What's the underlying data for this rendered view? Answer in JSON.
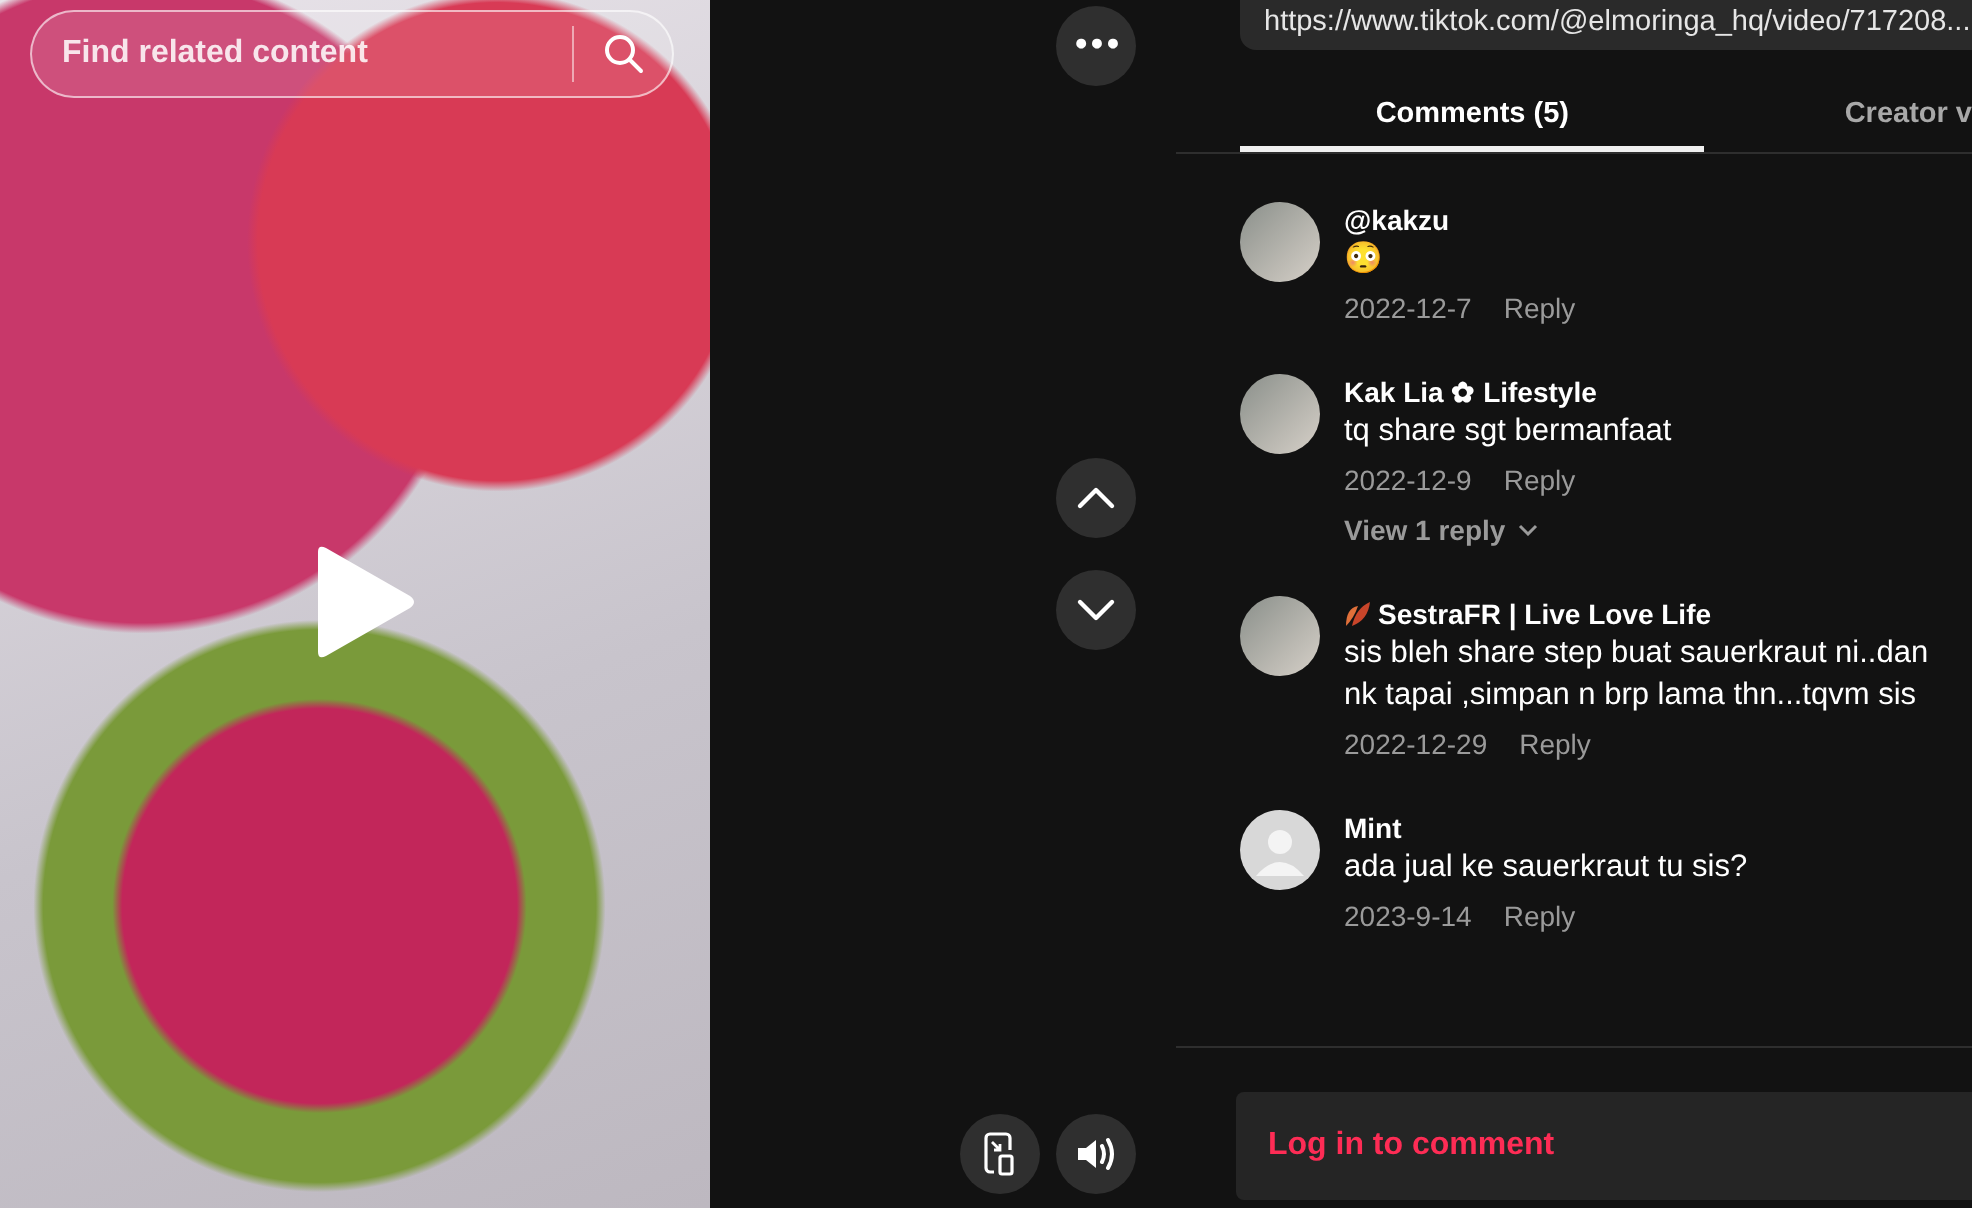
{
  "video": {
    "search": {
      "placeholder": "Find related content"
    }
  },
  "controls": {
    "more": "•••"
  },
  "share": {
    "url": "https://www.tiktok.com/@elmoringa_hq/video/717208..."
  },
  "tabs": [
    {
      "label": "Comments (5)",
      "selected": true
    },
    {
      "label": "Creator v",
      "selected": false
    }
  ],
  "comments": [
    {
      "kind": "photo",
      "author": "@kakzu",
      "lines": [
        "😳"
      ],
      "date": "2022-12-7",
      "reply": "Reply"
    },
    {
      "kind": "photo",
      "author": "Kak Lia ✿ Lifestyle",
      "lines": [
        "tq share sgt bermanfaat"
      ],
      "date": "2022-12-9",
      "reply": "Reply",
      "view_replies": "View 1 reply"
    },
    {
      "kind": "photo",
      "badge": true,
      "author": "SestraFR | Live Love Life",
      "lines": [
        "sis bleh share step buat sauerkraut ni..dan",
        "nk tapai ,simpan n brp lama thn...tqvm sis"
      ],
      "date": "2022-12-29",
      "reply": "Reply"
    },
    {
      "kind": "default",
      "author": "Mint",
      "lines": [
        "ada jual ke sauerkraut tu sis?"
      ],
      "date": "2023-9-14",
      "reply": "Reply"
    }
  ],
  "login": {
    "label": "Log in to comment"
  }
}
